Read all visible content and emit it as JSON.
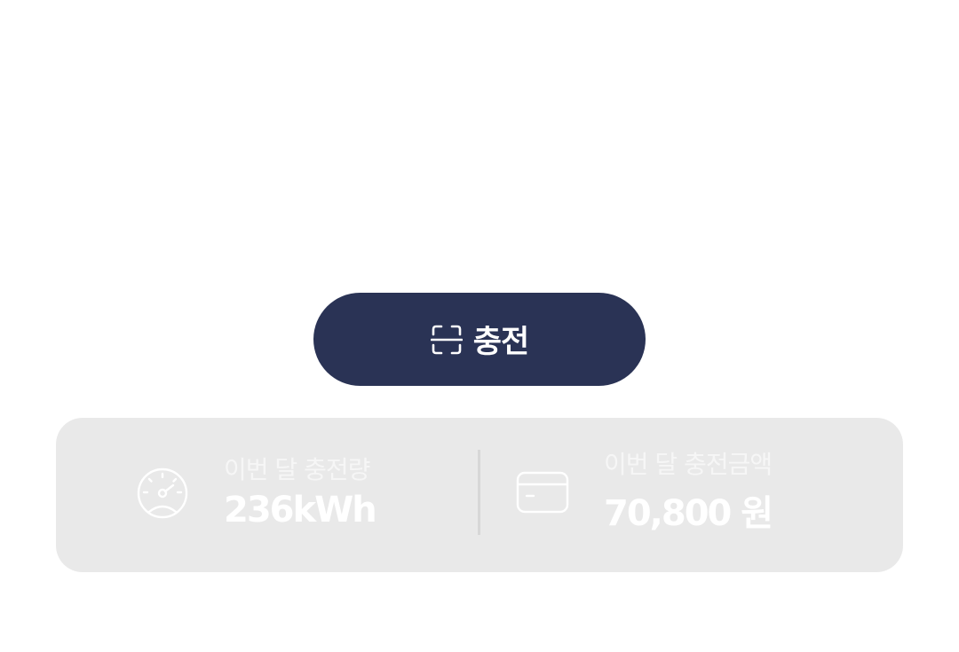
{
  "charge_button": {
    "label": "충전",
    "icon": "scan-icon",
    "color": "#2a3355"
  },
  "stats": {
    "energy": {
      "icon": "gauge-icon",
      "label": "이번 달 충전량",
      "value": "236kWh"
    },
    "cost": {
      "icon": "card-icon",
      "label": "이번 달 충전금액",
      "value": "70,800 원"
    },
    "card_color": "#e9e9e9"
  }
}
